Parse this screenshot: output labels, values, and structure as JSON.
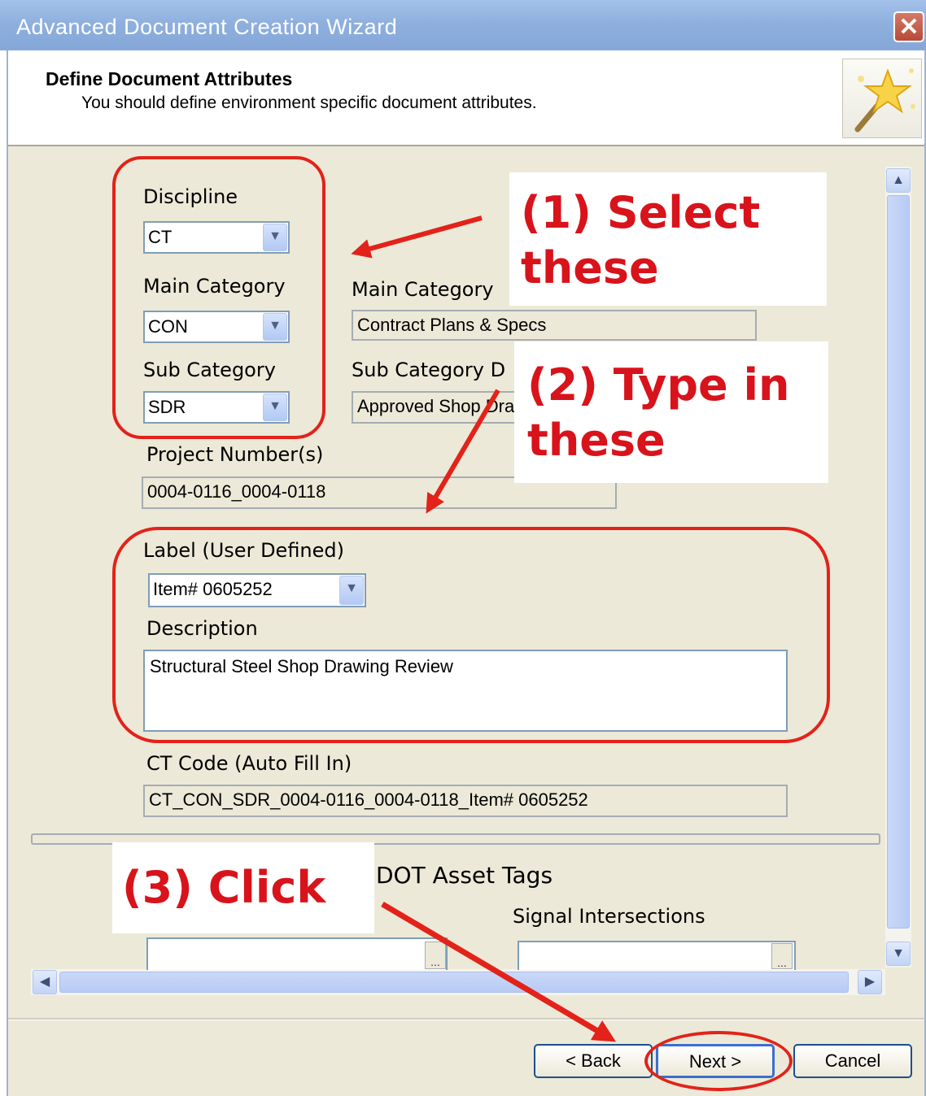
{
  "window": {
    "title": "Advanced Document Creation Wizard"
  },
  "header": {
    "title": "Define Document Attributes",
    "subtitle": "You should define environment specific document attributes."
  },
  "form": {
    "discipline_label": "Discipline",
    "discipline_value": "CT",
    "main_category_label": "Main Category",
    "main_category_value": "CON",
    "main_category_desc_label": "Main Category",
    "main_category_desc_value": "Contract Plans & Specs",
    "sub_category_label": "Sub Category",
    "sub_category_value": "SDR",
    "sub_category_desc_label": "Sub Category D",
    "sub_category_desc_value": "Approved Shop Draw",
    "project_numbers_label": "Project Number(s)",
    "project_numbers_value": "0004-0116_0004-0118",
    "label_label": "Label (User Defined)",
    "label_value": "Item# 0605252",
    "description_label": "Description",
    "description_value": "Structural Steel Shop Drawing Review",
    "ct_code_label": "CT Code (Auto Fill In)",
    "ct_code_value": "CT_CON_SDR_0004-0116_0004-0118_Item# 0605252",
    "asset_tags_label": "DOT Asset Tags",
    "signal_label": "Signal Intersections",
    "browse_label": "..."
  },
  "annotations": {
    "step1_line1": "(1) Select",
    "step1_line2": "these",
    "step2_line1": "(2) Type in",
    "step2_line2": "these",
    "step3": "(3) Click"
  },
  "buttons": {
    "back": "< Back",
    "next": "Next >",
    "cancel": "Cancel"
  },
  "colors": {
    "annotation_red": "#e32219",
    "title_bar": "#8fb0de",
    "dialog_bg": "#ece9d8"
  }
}
